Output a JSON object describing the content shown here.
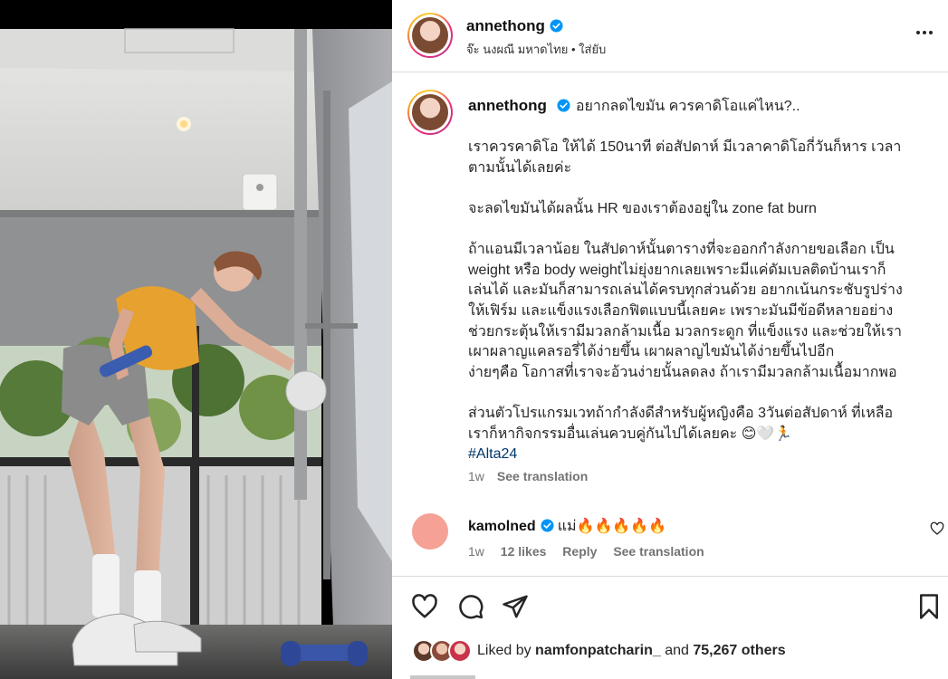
{
  "author": {
    "username": "annethong",
    "audio_artist": "จ๊ะ นงผณี มหาดไทย",
    "separator": "•",
    "audio_title": "ใส่ยับ"
  },
  "caption": {
    "headline": "อยากลดไขมัน ควรคาดิโอแค่ไหน?..",
    "p1": [
      "เราควรคาดิโอ ให้ได้ 150นาที ต่อสัปดาห์ มีเวลาคาดิโอกี่วันก็หาร เวลา",
      "ตามนั้นได้เลยค่ะ"
    ],
    "p2": [
      "จะลดไขมันได้ผลนั้น HR ของเราต้องอยู่ใน zone fat burn"
    ],
    "p3": [
      "ถ้าแอนมีเวลาน้อย ในสัปดาห์นั้นตารางที่จะออกกำลังกายขอเลือก เป็น",
      "weight หรือ body weightไม่ยุ่งยากเลยเพราะมีแค่ดัมเบลติดบ้านเราก็",
      "เล่นได้ และมันก็สามารถเล่นได้ครบทุกส่วนด้วย อยากเน้นกระชับรูปร่าง",
      "ให้เฟิร์ม และแข็งแรงเลือกฟิตแบบนี้เลยคะ เพราะมันมีข้อดีหลายอย่าง",
      "ช่วยกระตุ้นให้เรามีมวลกล้ามเนื้อ มวลกระดูก ที่แข็งแรง และช่วยให้เรา",
      "เผาผลาญแคลรอรี่ได้ง่ายขึ้น เผาผลาญไขมันได้ง่ายขึ้นไปอีก",
      "ง่ายๆคือ โอกาสที่เราจะอ้วนง่ายนั้นลดลง ถ้าเรามีมวลกล้ามเนื้อมากพอ"
    ],
    "p4": [
      "ส่วนตัวโปรแกรมเวทถ้ากำลังดีสำหรับผู้หญิงคือ 3วันต่อสัปดาห์ ที่เหลือ",
      "เราก็หากิจกรรมอื่นเล่นควบคู่กันไปได้เลยคะ 😊🤍🏃"
    ],
    "hashtag": "#Alta24",
    "age": "1w",
    "see_translation": "See translation"
  },
  "comment": {
    "username": "kamolned",
    "text": "แม่🔥🔥🔥🔥🔥",
    "age": "1w",
    "likes": "12 likes",
    "reply": "Reply",
    "see_translation": "See translation"
  },
  "likes": {
    "prefix": "Liked by",
    "user": "namfonpatcharin_",
    "and": "and",
    "others": "75,267 others"
  },
  "colors": {
    "link": "#00376b",
    "verified": "#0095f6",
    "muted_text": "#737373",
    "divider": "#dbdbdb"
  },
  "icons": [
    "verified-badge-icon",
    "more-options-icon",
    "like-heart-icon",
    "comment-bubble-icon",
    "share-paper-plane-icon",
    "save-bookmark-icon",
    "comment-like-heart-icon"
  ]
}
